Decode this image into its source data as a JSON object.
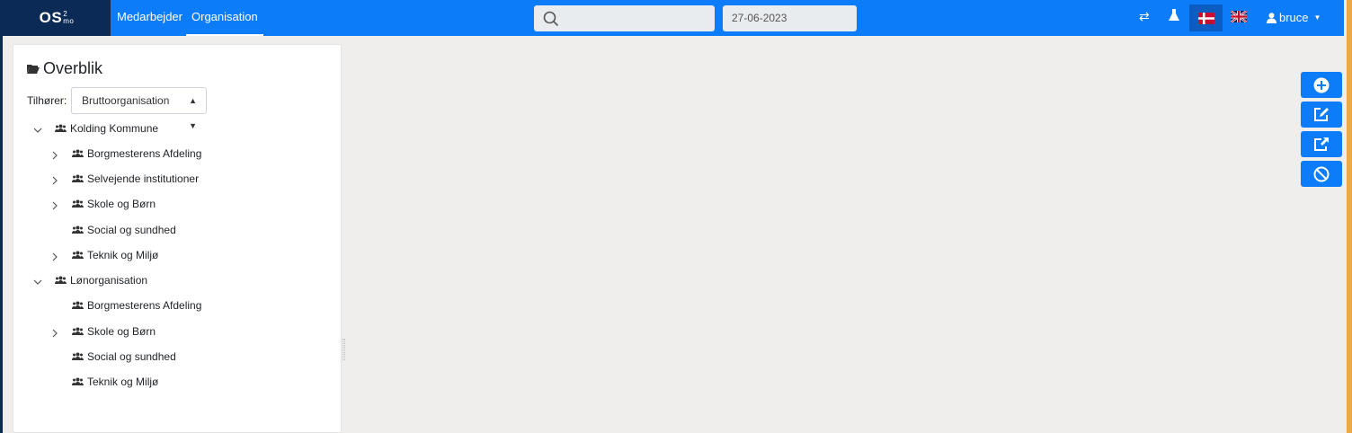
{
  "brand": {
    "name": "OS",
    "sup_top": "2",
    "sup_bottom": "mo"
  },
  "nav": {
    "items": [
      "Medarbejder",
      "Organisation"
    ],
    "active": "Organisation"
  },
  "search": {
    "placeholder": "",
    "icon": "search-icon"
  },
  "date": {
    "value": "27-06-2023"
  },
  "header_icons": [
    "swap-icon",
    "flask-icon",
    "flag-dk-icon",
    "flag-uk-icon"
  ],
  "user": {
    "name": "bruce"
  },
  "panel": {
    "title": "Overblik",
    "belongs_label": "Tilhører:",
    "select_value": "Bruttoorganisation"
  },
  "tree": [
    {
      "label": "Kolding Kommune",
      "expanded": true,
      "level": 0
    },
    {
      "label": "Borgmesterens Afdeling",
      "has_children": true,
      "level": 1
    },
    {
      "label": "Selvejende institutioner",
      "has_children": true,
      "level": 1
    },
    {
      "label": "Skole og Børn",
      "has_children": true,
      "level": 1
    },
    {
      "label": "Social og sundhed",
      "has_children": false,
      "level": 1
    },
    {
      "label": "Teknik og Miljø",
      "has_children": true,
      "level": 1
    },
    {
      "label": "Lønorganisation",
      "expanded": true,
      "level": 0
    },
    {
      "label": "Borgmesterens Afdeling",
      "has_children": false,
      "level": 1
    },
    {
      "label": "Skole og Børn",
      "has_children": true,
      "level": 1
    },
    {
      "label": "Social og sundhed",
      "has_children": false,
      "level": 1
    },
    {
      "label": "Teknik og Miljø",
      "has_children": false,
      "level": 1
    }
  ],
  "actions": [
    "add-icon",
    "edit-icon",
    "move-icon",
    "terminate-icon"
  ],
  "colors": {
    "primary": "#0d7cf8",
    "brand_bg": "#0b2a55",
    "page_bg": "#f0eeec"
  }
}
